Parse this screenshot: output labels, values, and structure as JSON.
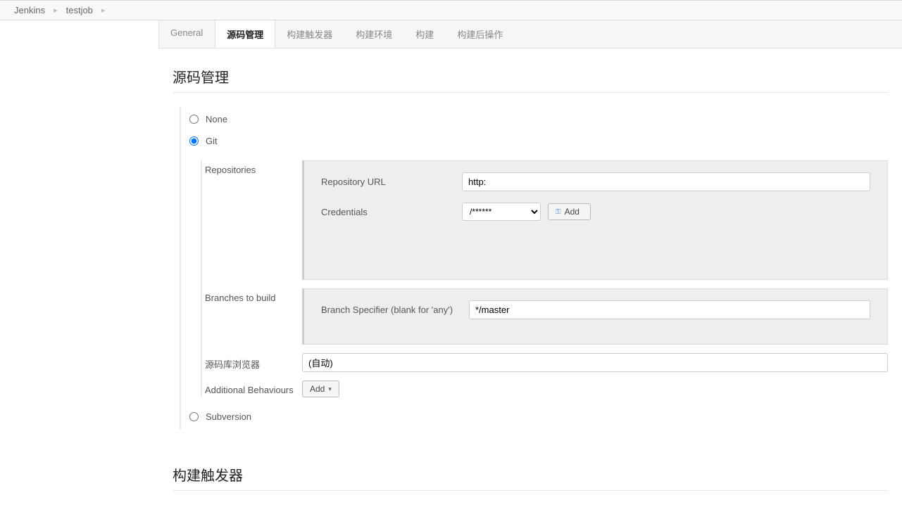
{
  "breadcrumb": {
    "items": [
      "Jenkins",
      "testjob"
    ]
  },
  "tabs": [
    {
      "label": "General",
      "active": false
    },
    {
      "label": "源码管理",
      "active": true
    },
    {
      "label": "构建触发器",
      "active": false
    },
    {
      "label": "构建环境",
      "active": false
    },
    {
      "label": "构建",
      "active": false
    },
    {
      "label": "构建后操作",
      "active": false
    }
  ],
  "section": {
    "scm_heading": "源码管理",
    "triggers_heading": "构建触发器"
  },
  "scm": {
    "none_label": "None",
    "git_label": "Git",
    "subversion_label": "Subversion",
    "selected": "git",
    "repositories_label": "Repositories",
    "repo_url_label": "Repository URL",
    "repo_url_value": "http:",
    "credentials_label": "Credentials",
    "credentials_selected": "/******",
    "add_button_label": "Add",
    "branches_label": "Branches to build",
    "branch_specifier_label": "Branch Specifier (blank for 'any')",
    "branch_specifier_value": "*/master",
    "browser_label": "源码库浏览器",
    "browser_value": "(自动)",
    "additional_label": "Additional Behaviours",
    "additional_add_label": "Add"
  }
}
